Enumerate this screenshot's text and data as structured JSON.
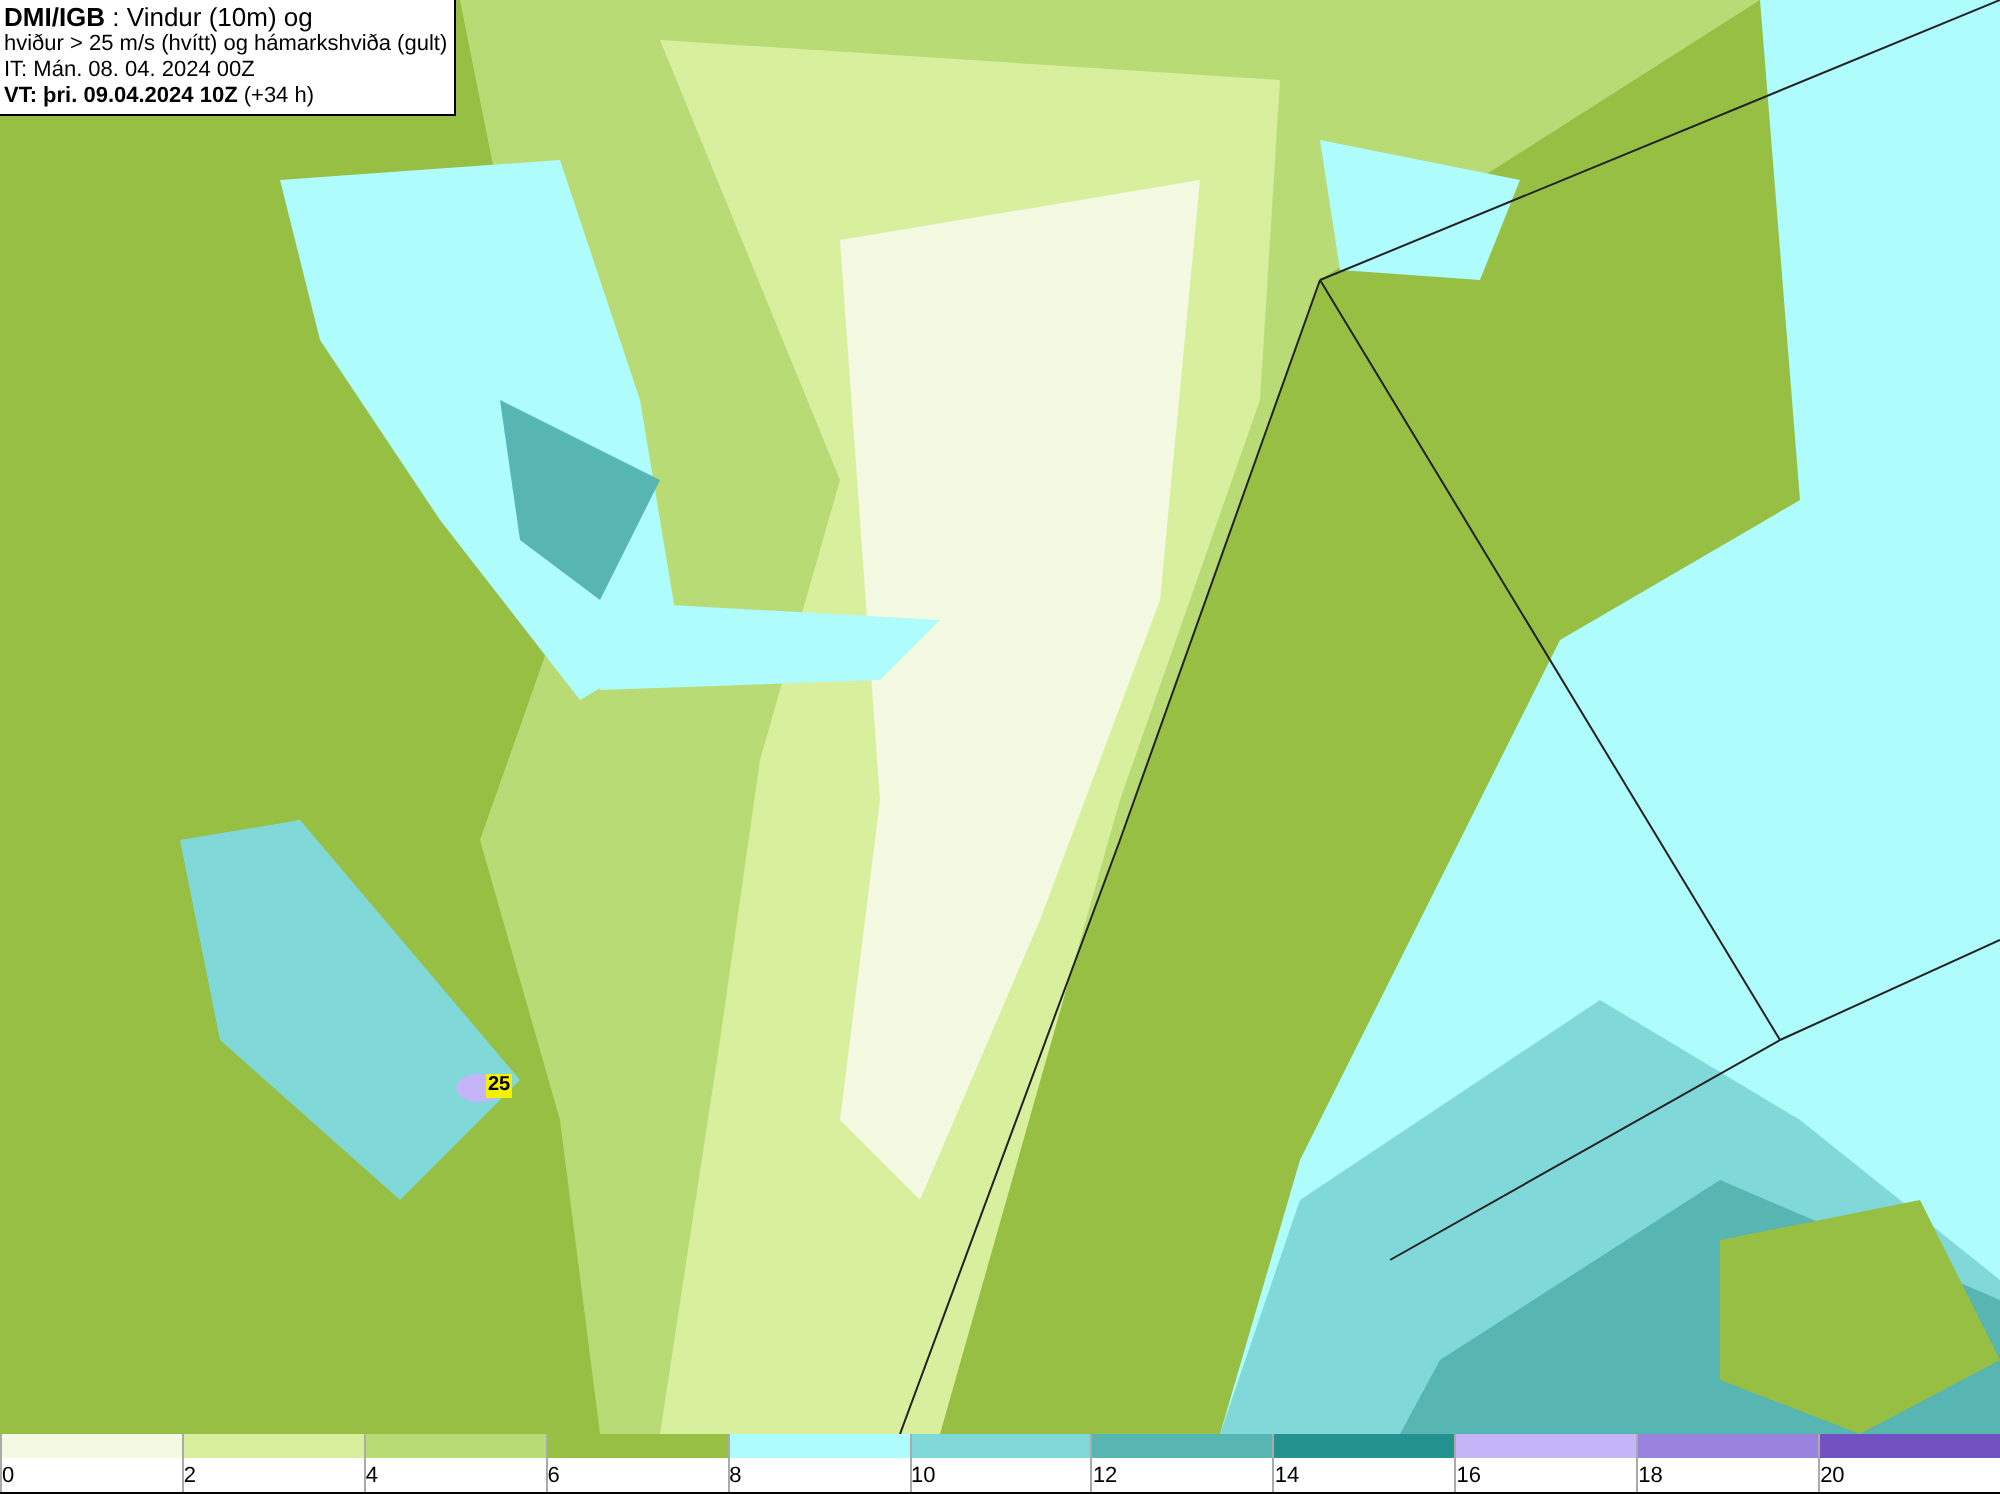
{
  "header": {
    "lines": [
      "**DMI/IGB** : Vindur (10m) og",
      "hviður > 25 m/s (hvítt) og hámarkshviða (gult)",
      "IT: Mán. 08. 04. 2024 00Z",
      "**VT: þri. 09.04.2024 10Z** (+34 h)"
    ]
  },
  "map": {
    "gust_label": "25"
  },
  "legend": [
    {
      "tick": "0",
      "color": "#f4fae2"
    },
    {
      "tick": "2",
      "color": "#d8ef9e"
    },
    {
      "tick": "4",
      "color": "#b8db76"
    },
    {
      "tick": "6",
      "color": "#96bf44"
    },
    {
      "tick": "8",
      "color": "#affcfc"
    },
    {
      "tick": "10",
      "color": "#80d9d8"
    },
    {
      "tick": "12",
      "color": "#57b5b2"
    },
    {
      "tick": "14",
      "color": "#24938f"
    },
    {
      "tick": "16",
      "color": "#c5b5f8"
    },
    {
      "tick": "18",
      "color": "#9a83df"
    },
    {
      "tick": "20",
      "color": "#7152c0"
    }
  ]
}
